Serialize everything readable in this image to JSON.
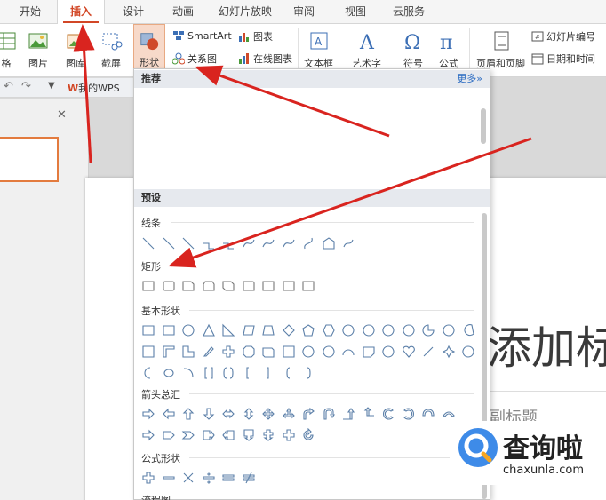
{
  "tabs": [
    {
      "label": "开始"
    },
    {
      "label": "插入"
    },
    {
      "label": "设计"
    },
    {
      "label": "动画"
    },
    {
      "label": "幻灯片放映"
    },
    {
      "label": "审阅"
    },
    {
      "label": "视图"
    },
    {
      "label": "云服务"
    }
  ],
  "ribbon": {
    "table_label": "格",
    "picture_label": "图片",
    "gallery_label": "图库",
    "screenshot_label": "截屏",
    "shape_label": "形状",
    "smartart_label": "SmartArt",
    "chart_label": "图表",
    "relation_label": "关系图",
    "online_chart_label": "在线图表",
    "textbox_label": "文本框",
    "arttext_label": "艺术字",
    "symbol_label": "符号",
    "formula_label": "公式",
    "header_footer_label": "页眉和页脚",
    "slide_number_label": "幻灯片编号",
    "datetime_label": "日期和时间"
  },
  "quick": {
    "wps_label": "我的WPS"
  },
  "dropdown": {
    "recommend": "推荐",
    "more": "更多»",
    "preset": "预设",
    "sections": {
      "lines": "线条",
      "rect": "矩形",
      "basic": "基本形状",
      "arrows": "箭头总汇",
      "formula": "公式形状",
      "flow": "流程图"
    }
  },
  "slide": {
    "title": "添加标题",
    "subtitle": "副标题"
  },
  "watermark": {
    "brand": "查询啦",
    "url": "chaxunla.com"
  },
  "colors": {
    "accent": "#d24726",
    "arrow": "#d9241f",
    "shape_stroke": "#5b7fa8"
  }
}
